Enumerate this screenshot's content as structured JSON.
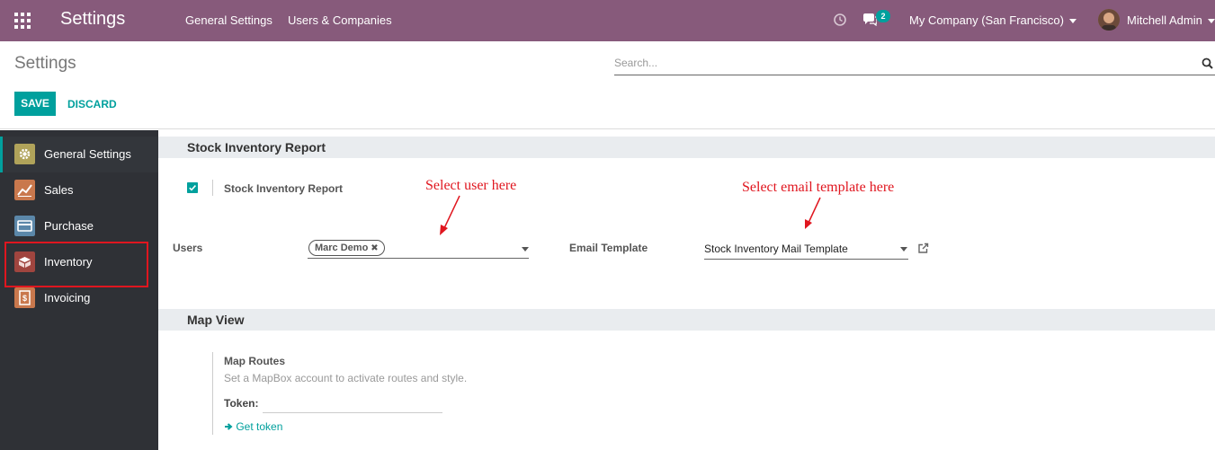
{
  "navbar": {
    "brand": "Settings",
    "menu": [
      "General Settings",
      "Users & Companies"
    ],
    "chat_count": "2",
    "company": "My Company (San Francisco)",
    "user": "Mitchell Admin"
  },
  "control": {
    "title": "Settings",
    "search_placeholder": "Search...",
    "save_label": "SAVE",
    "discard_label": "DISCARD"
  },
  "sidebar": {
    "items": [
      {
        "label": "General Settings",
        "icon": "gear-icon",
        "color": "#b0a35a"
      },
      {
        "label": "Sales",
        "icon": "chart-icon",
        "color": "#c9784d"
      },
      {
        "label": "Purchase",
        "icon": "credit-card-icon",
        "color": "#5b87a9"
      },
      {
        "label": "Inventory",
        "icon": "box-icon",
        "color": "#a0453f"
      },
      {
        "label": "Invoicing",
        "icon": "invoice-icon",
        "color": "#c9784d"
      }
    ]
  },
  "sections": {
    "stock_report": {
      "title": "Stock Inventory Report",
      "checkbox_label": "Stock Inventory Report",
      "users_label": "Users",
      "user_tag": "Marc Demo",
      "email_template_label": "Email Template",
      "email_template_value": "Stock Inventory Mail Template"
    },
    "map_view": {
      "title": "Map View",
      "routes_title": "Map Routes",
      "routes_desc": "Set a MapBox account to activate routes and style.",
      "token_label": "Token:",
      "get_token": "Get token"
    }
  },
  "annotations": {
    "select_user": "Select user here",
    "select_template": "Select email template here"
  },
  "colors": {
    "navbar": "#875a7b",
    "accent": "#00a09d",
    "sidebar": "#2f3136",
    "annotation": "#e0161f"
  }
}
